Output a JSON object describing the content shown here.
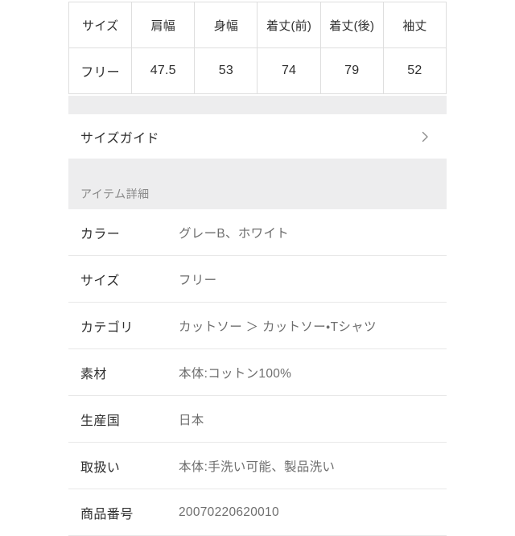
{
  "size_table": {
    "headers": [
      "サイズ",
      "肩幅",
      "身幅",
      "着丈(前)",
      "着丈(後)",
      "袖丈"
    ],
    "rows": [
      [
        "フリー",
        "47.5",
        "53",
        "74",
        "79",
        "52"
      ]
    ]
  },
  "size_guide": {
    "label": "サイズガイド",
    "chevron_icon": "chevron-right-icon"
  },
  "item_detail": {
    "section_title": "アイテム詳細",
    "rows": [
      {
        "label": "カラー",
        "value": "グレーB、ホワイト"
      },
      {
        "label": "サイズ",
        "value": "フリー"
      },
      {
        "label": "カテゴリ",
        "value": "カットソー ＞ カットソー・Tシャツ"
      },
      {
        "label": "素材",
        "value": "本体:コットン100%"
      },
      {
        "label": "生産国",
        "value": "日本"
      },
      {
        "label": "取扱い",
        "value": "本体:手洗い可能、製品洗い"
      },
      {
        "label": "商品番号",
        "value": "20070220620010"
      }
    ]
  },
  "colors": {
    "page_background": "#ffffff",
    "band_gray": "#ededee",
    "table_border": "#dedede",
    "row_divider": "#e8e8e8",
    "label_text": "#2f2f2f",
    "value_text": "#6e6e6e",
    "section_title_text": "#8a8a8a"
  }
}
